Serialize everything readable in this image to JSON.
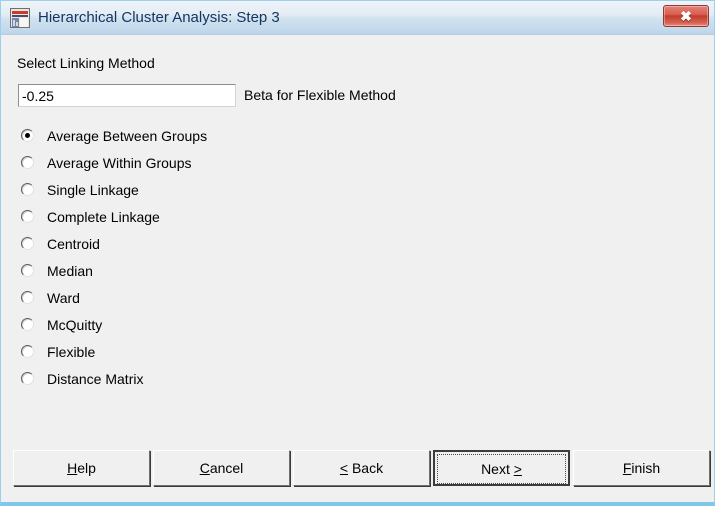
{
  "window": {
    "title": "Hierarchical Cluster Analysis: Step 3",
    "icon": "chart-document-icon",
    "close_label": "✖",
    "close_icon": "close-icon",
    "titlebar_color": "#c3d9ec",
    "background_color": "#f0f0f0",
    "border_color": "#9bd0e8",
    "close_button_color": "#c13a2b"
  },
  "form": {
    "section_label": "Select Linking Method",
    "beta_input": {
      "value": "-0.25",
      "placeholder": ""
    },
    "beta_label": "Beta for Flexible Method",
    "options": [
      {
        "label": "Average Between Groups",
        "checked": true
      },
      {
        "label": "Average Within Groups",
        "checked": false
      },
      {
        "label": "Single Linkage",
        "checked": false
      },
      {
        "label": "Complete Linkage",
        "checked": false
      },
      {
        "label": "Centroid",
        "checked": false
      },
      {
        "label": "Median",
        "checked": false
      },
      {
        "label": "Ward",
        "checked": false
      },
      {
        "label": "McQuitty",
        "checked": false
      },
      {
        "label": "Flexible",
        "checked": false
      },
      {
        "label": "Distance Matrix",
        "checked": false
      }
    ]
  },
  "buttons": {
    "help": {
      "accel": "H",
      "rest": "elp"
    },
    "cancel": {
      "accel": "C",
      "rest": "ancel"
    },
    "back": {
      "accel": "<",
      "rest": " Back"
    },
    "next": {
      "pre": "Next ",
      "accel": ">"
    },
    "finish": {
      "accel": "F",
      "rest": "inish"
    }
  }
}
